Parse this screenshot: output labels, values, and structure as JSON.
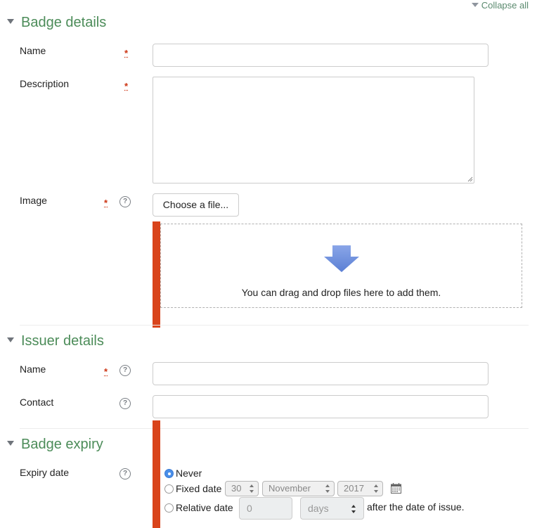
{
  "header": {
    "collapse_all": "Collapse all"
  },
  "badge_details": {
    "title": "Badge details",
    "name_label": "Name",
    "description_label": "Description",
    "image_label": "Image",
    "choose_file_button": "Choose a file...",
    "dropzone_text": "You can drag and drop files here to add them."
  },
  "issuer_details": {
    "title": "Issuer details",
    "name_label": "Name",
    "contact_label": "Contact"
  },
  "badge_expiry": {
    "title": "Badge expiry",
    "expiry_label": "Expiry date",
    "option_never": "Never",
    "option_fixed": "Fixed date",
    "option_relative": "Relative date",
    "selected_option": "Never",
    "day_value": "30",
    "month_value": "November",
    "year_value": "2017",
    "relative_number": "0",
    "relative_unit": "days",
    "after_text": "after the date of issue."
  },
  "required_marker": "*",
  "help_glyph": "?",
  "colors": {
    "section_title": "#4c8c59",
    "error_bar": "#d9441b",
    "required_marker": "#cc3311",
    "radio_selected": "#4a8ee8"
  },
  "icons": [
    "collapse-triangle-icon",
    "section-triangle-icon",
    "required-icon",
    "help-icon",
    "download-arrow-icon",
    "calendar-icon"
  ]
}
